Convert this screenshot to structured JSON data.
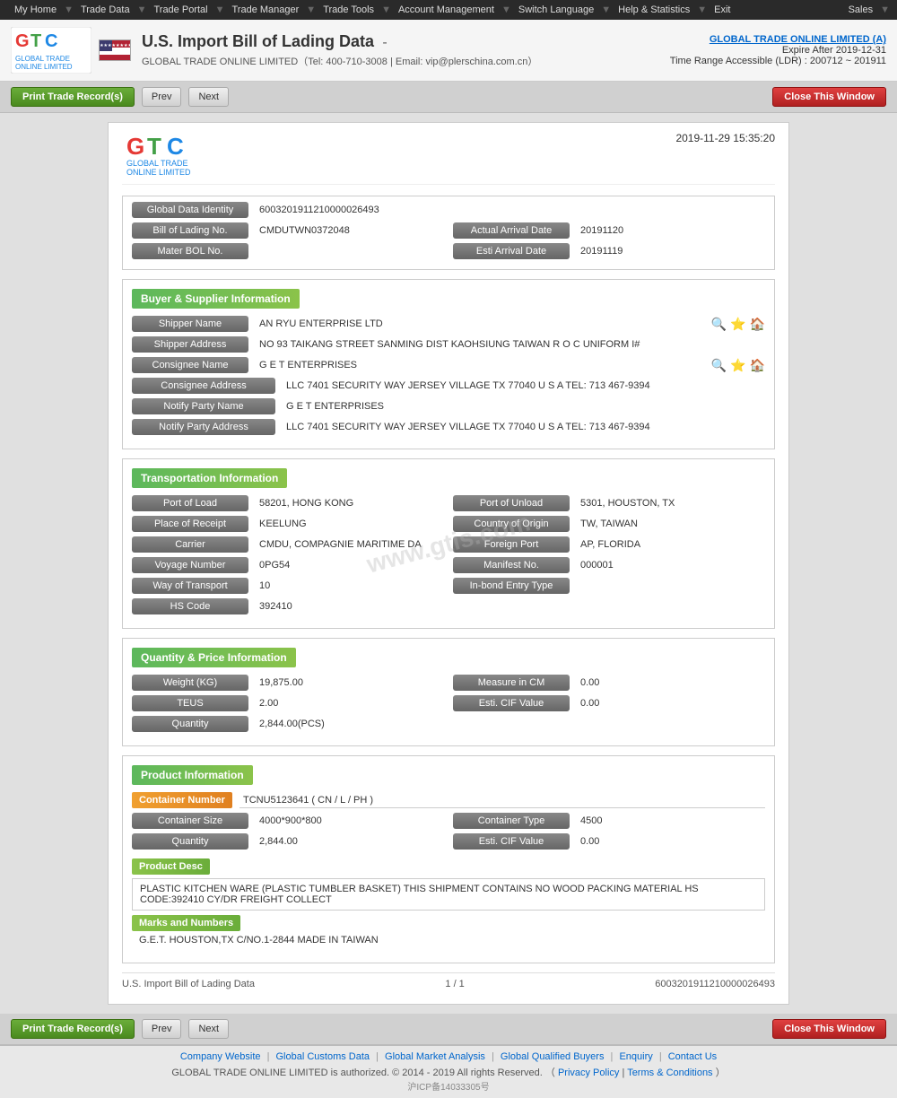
{
  "topnav": {
    "items": [
      "My Home",
      "Trade Data",
      "Trade Portal",
      "Trade Manager",
      "Trade Tools",
      "Account Management",
      "Switch Language",
      "Help & Statistics",
      "Exit"
    ],
    "sales_label": "Sales"
  },
  "header": {
    "title": "U.S. Import Bill of Lading Data",
    "separator": "-",
    "company_line": "GLOBAL TRADE ONLINE LIMITED（Tel: 400-710-3008 | Email: vip@plerschina.com.cn）",
    "account_company": "GLOBAL TRADE ONLINE LIMITED (A)",
    "expire": "Expire After 2019-12-31",
    "ldr": "Time Range Accessible (LDR) : 200712 ~ 201911"
  },
  "toolbar": {
    "print_label": "Print Trade Record(s)",
    "prev_label": "Prev",
    "next_label": "Next",
    "close_label": "Close This Window"
  },
  "doc": {
    "timestamp": "2019-11-29 15:35:20",
    "logo_text": "GTC",
    "logo_sub": "GLOBAL TRADE ONLINE LIMITED",
    "global_data_identity_label": "Global Data Identity",
    "global_data_identity_value": "6003201911210000026493",
    "bill_of_lading_label": "Bill of Lading No.",
    "bill_of_lading_value": "CMDUTWN0372048",
    "actual_arrival_date_label": "Actual Arrival Date",
    "actual_arrival_date_value": "20191120",
    "master_bol_label": "Mater BOL No.",
    "esti_arrival_date_label": "Esti Arrival Date",
    "esti_arrival_date_value": "20191119",
    "buyer_supplier_section": "Buyer & Supplier Information",
    "shipper_name_label": "Shipper Name",
    "shipper_name_value": "AN RYU ENTERPRISE LTD",
    "shipper_address_label": "Shipper Address",
    "shipper_address_value": "NO 93 TAIKANG STREET SANMING DIST KAOHSIUNG TAIWAN R O C UNIFORM I#",
    "consignee_name_label": "Consignee Name",
    "consignee_name_value": "G E T ENTERPRISES",
    "consignee_address_label": "Consignee Address",
    "consignee_address_value": "LLC 7401 SECURITY WAY JERSEY VILLAGE TX 77040 U S A TEL: 713 467-9394",
    "notify_party_name_label": "Notify Party Name",
    "notify_party_name_value": "G E T ENTERPRISES",
    "notify_party_address_label": "Notify Party Address",
    "notify_party_address_value": "LLC 7401 SECURITY WAY JERSEY VILLAGE TX 77040 U S A TEL: 713 467-9394",
    "transportation_section": "Transportation Information",
    "port_of_load_label": "Port of Load",
    "port_of_load_value": "58201, HONG KONG",
    "port_of_unload_label": "Port of Unload",
    "port_of_unload_value": "5301, HOUSTON, TX",
    "place_of_receipt_label": "Place of Receipt",
    "place_of_receipt_value": "KEELUNG",
    "country_of_origin_label": "Country of Origin",
    "country_of_origin_value": "TW, TAIWAN",
    "carrier_label": "Carrier",
    "carrier_value": "CMDU, COMPAGNIE MARITIME DA",
    "foreign_port_label": "Foreign Port",
    "foreign_port_value": "AP, FLORIDA",
    "voyage_number_label": "Voyage Number",
    "voyage_number_value": "0PG54",
    "manifest_no_label": "Manifest No.",
    "manifest_no_value": "000001",
    "way_of_transport_label": "Way of Transport",
    "way_of_transport_value": "10",
    "in_bond_entry_type_label": "In-bond Entry Type",
    "in_bond_entry_type_value": "",
    "hs_code_label": "HS Code",
    "hs_code_value": "392410",
    "quantity_price_section": "Quantity & Price Information",
    "weight_kg_label": "Weight (KG)",
    "weight_kg_value": "19,875.00",
    "measure_in_cm_label": "Measure in CM",
    "measure_in_cm_value": "0.00",
    "teus_label": "TEUS",
    "teus_value": "2.00",
    "esti_cif_value_label": "Esti. CIF Value",
    "esti_cif_value_value": "0.00",
    "quantity_label": "Quantity",
    "quantity_value": "2,844.00(PCS)",
    "product_info_section": "Product Information",
    "container_number_label": "Container Number",
    "container_number_value": "TCNU5123641 ( CN / L / PH )",
    "container_size_label": "Container Size",
    "container_size_value": "4000*900*800",
    "container_type_label": "Container Type",
    "container_type_value": "4500",
    "quantity2_label": "Quantity",
    "quantity2_value": "2,844.00",
    "esti_cif_value2_label": "Esti. CIF Value",
    "esti_cif_value2_value": "0.00",
    "product_desc_label": "Product Desc",
    "product_desc_value": "PLASTIC KITCHEN WARE (PLASTIC TUMBLER BASKET) THIS SHIPMENT CONTAINS NO WOOD PACKING MATERIAL HS CODE:392410 CY/DR FREIGHT COLLECT",
    "marks_and_numbers_label": "Marks and Numbers",
    "marks_and_numbers_value": "G.E.T. HOUSTON,TX C/NO.1-2844 MADE IN TAIWAN",
    "footer_doc_title": "U.S. Import Bill of Lading Data",
    "footer_page": "1 / 1",
    "footer_id": "6003201911210000026493"
  },
  "bottom_footer": {
    "icp": "沪ICP备14033305号",
    "links": [
      "Company Website",
      "Global Customs Data",
      "Global Market Analysis",
      "Global Qualified Buyers",
      "Enquiry",
      "Contact Us"
    ],
    "copyright": "GLOBAL TRADE ONLINE LIMITED is authorized. © 2014 - 2019 All rights Reserved.  （",
    "privacy_policy": "Privacy Policy",
    "terms": "Terms & Conditions",
    "copyright_end": "）"
  },
  "watermark": "www.gtis.com"
}
